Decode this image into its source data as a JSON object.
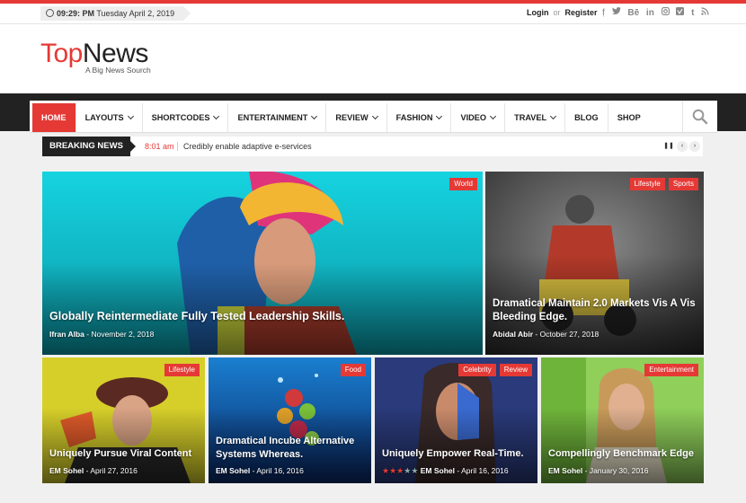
{
  "topbar": {
    "time": "09:29: PM",
    "date": "Tuesday April 2, 2019",
    "login": "Login",
    "or": "or",
    "register": "Register",
    "social_icons": [
      "facebook-icon",
      "twitter-icon",
      "behance-icon",
      "linkedin-icon",
      "instagram-icon",
      "vimeo-icon",
      "tumblr-icon",
      "rss-icon"
    ]
  },
  "logo": {
    "top": "Top",
    "news": "News",
    "tagline": "A Big News Sourch"
  },
  "nav": {
    "home": "HOME",
    "layouts": "LAYOUTS",
    "shortcodes": "SHORTCODES",
    "entertainment": "ENTERTAINMENT",
    "review": "REVIEW",
    "fashion": "FASHION",
    "video": "VIDEO",
    "travel": "TRAVEL",
    "blog": "BLOG",
    "shop": "SHOP"
  },
  "breaking": {
    "label": "BREAKING NEWS",
    "time": "8:01 am",
    "text": "Credibly enable adaptive e-services"
  },
  "posts": [
    {
      "title": "Globally Reintermediate Fully Tested Leadership Skills.",
      "author": "Ifran Alba",
      "date": "November 2, 2018",
      "cats": [
        "World"
      ]
    },
    {
      "title": "Dramatical Maintain 2.0 Markets Vis A Vis Bleeding Edge.",
      "author": "Abidal Abir",
      "date": "October 27, 2018",
      "cats": [
        "Lifestyle",
        "Sports"
      ]
    },
    {
      "title": "Uniquely Pursue Viral Content",
      "author": "EM Sohel",
      "date": "April 27, 2016",
      "cats": [
        "Lifestyle"
      ]
    },
    {
      "title": "Dramatical Incube Alternative Systems Whereas.",
      "author": "EM Sohel",
      "date": "April 16, 2016",
      "cats": [
        "Food"
      ]
    },
    {
      "title": "Uniquely Empower Real-Time.",
      "author": "EM Sohel",
      "date": "April 16, 2016",
      "cats": [
        "Celebrity",
        "Review"
      ],
      "rating": 3,
      "rating_max": 5
    },
    {
      "title": "Compellingly Benchmark Edge",
      "author": "EM Sohel",
      "date": "January 30, 2016",
      "cats": [
        "Entertainment"
      ]
    }
  ],
  "colors": {
    "accent": "#e53935",
    "dark": "#222222"
  }
}
